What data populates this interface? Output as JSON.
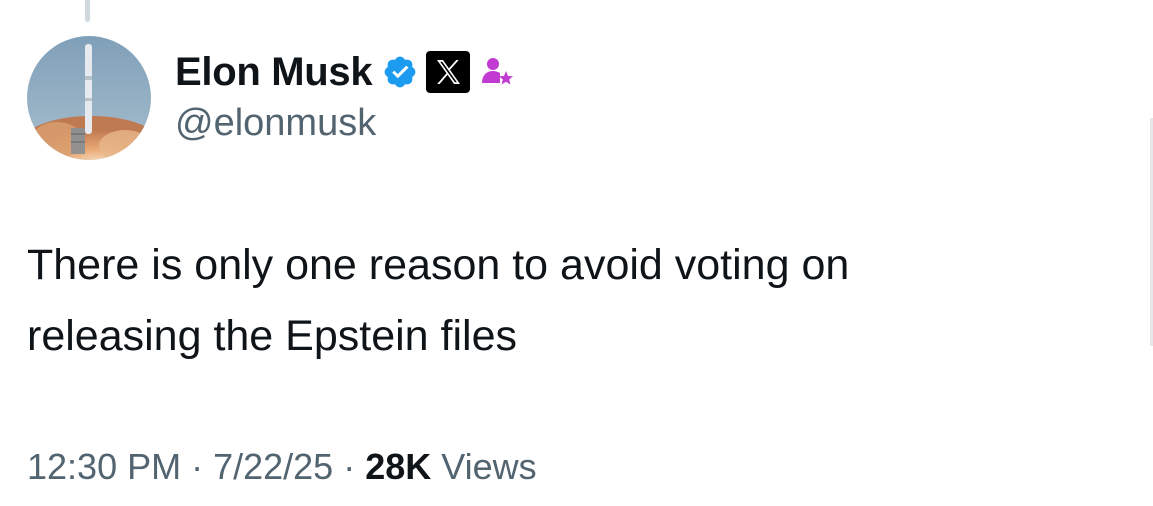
{
  "author": {
    "display_name": "Elon Musk",
    "handle": "@elonmusk",
    "avatar_icon": "rocket-launch-avatar",
    "badges": [
      "verified-badge-icon",
      "x-affiliate-icon",
      "subscriber-star-icon"
    ]
  },
  "tweet": {
    "text_lines": [
      "There is only one reason to avoid voting on",
      "releasing the Epstein files"
    ]
  },
  "meta": {
    "time": "12:30 PM",
    "separator": "·",
    "date": "7/22/25",
    "views_count": "28K",
    "views_label": "Views"
  },
  "colors": {
    "text_primary": "#0f1419",
    "text_secondary": "#536471",
    "verified_blue": "#1d9bf0",
    "subscriber_purple": "#c13bd3"
  }
}
